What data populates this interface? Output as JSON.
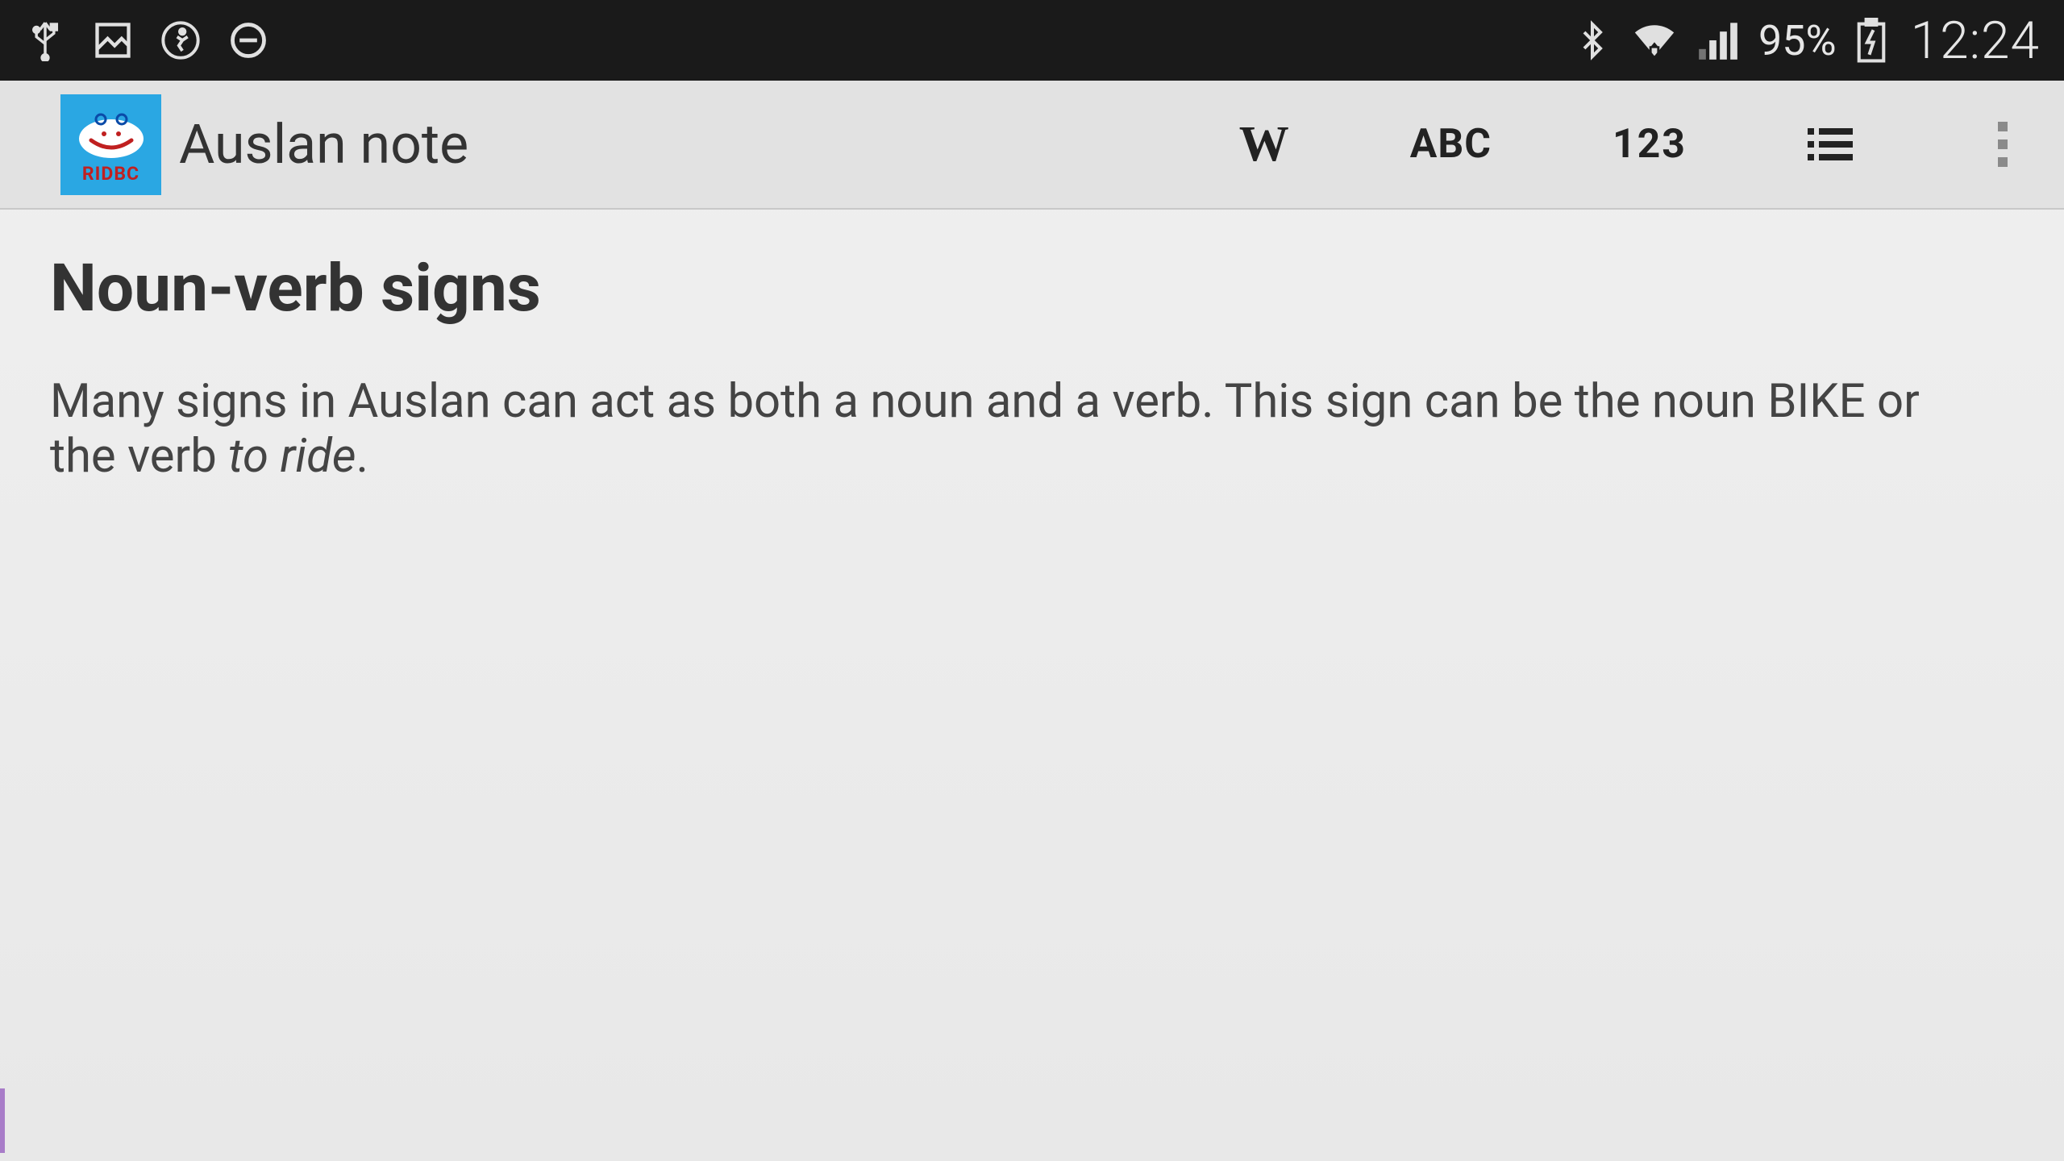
{
  "status": {
    "battery_percent": "95%",
    "time": "12:24"
  },
  "appbar": {
    "logo_brand": "RIDBC",
    "title": "Auslan note",
    "actions": {
      "w": "W",
      "abc": "ABC",
      "num": "123"
    }
  },
  "content": {
    "heading": "Noun-verb signs",
    "body_pre": "Many signs in Auslan can act as both a noun and a verb. This sign can be the noun BIKE or the verb ",
    "body_italic": "to ride",
    "body_post": "."
  }
}
